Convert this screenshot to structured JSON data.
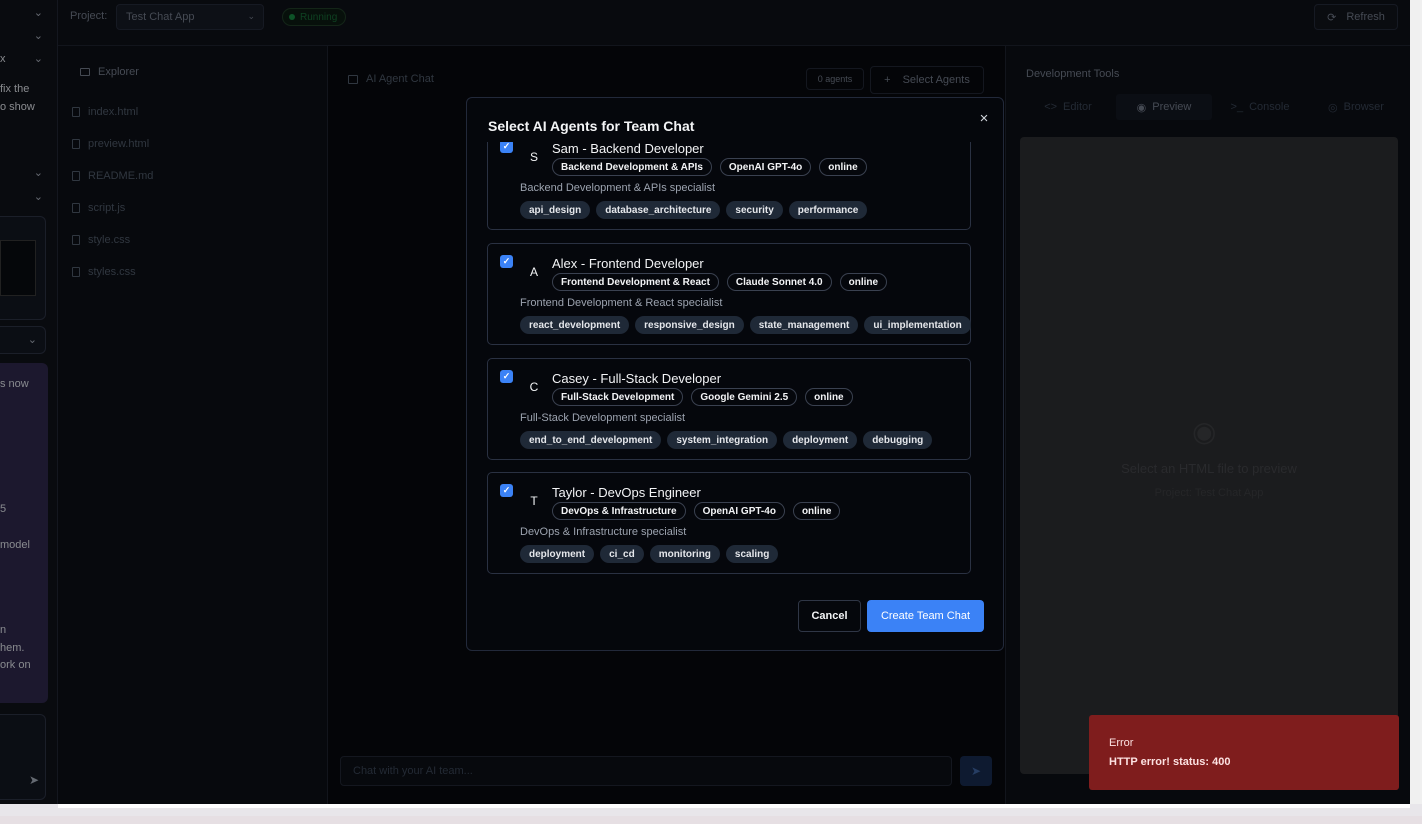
{
  "left_strip": {
    "texts": [
      "x",
      "fix the",
      "o show",
      "s now",
      "5",
      "model",
      "n",
      "hem.",
      "ork on"
    ]
  },
  "topbar": {
    "project_label": "Project:",
    "project_value": "Test Chat App",
    "status": "Running",
    "refresh_label": "Refresh"
  },
  "explorer": {
    "title": "Explorer",
    "files": [
      "index.html",
      "preview.html",
      "README.md",
      "script.js",
      "style.css",
      "styles.css"
    ]
  },
  "chat": {
    "title": "AI Agent Chat",
    "agents_count": "0 agents",
    "select_agents_label": "Select Agents",
    "input_placeholder": "Chat with your AI team..."
  },
  "devtools": {
    "title": "Development Tools",
    "tabs": [
      "Editor",
      "Preview",
      "Console",
      "Browser"
    ],
    "active_tab": "Preview",
    "preview_message": "Select an HTML file to preview",
    "preview_project": "Project: Test Chat App"
  },
  "modal": {
    "title": "Select AI Agents for Team Chat",
    "close": "×",
    "agents": [
      {
        "initial": "S",
        "name": "Sam - Backend Developer",
        "specialty": "Backend Development & APIs",
        "model": "OpenAI GPT-4o",
        "status": "online",
        "description": "Backend Development & APIs specialist",
        "skills": [
          "api_design",
          "database_architecture",
          "security",
          "performance"
        ],
        "checked": true
      },
      {
        "initial": "A",
        "name": "Alex - Frontend Developer",
        "specialty": "Frontend Development & React",
        "model": "Claude Sonnet 4.0",
        "status": "online",
        "description": "Frontend Development & React specialist",
        "skills": [
          "react_development",
          "responsive_design",
          "state_management",
          "ui_implementation"
        ],
        "checked": true
      },
      {
        "initial": "C",
        "name": "Casey - Full-Stack Developer",
        "specialty": "Full-Stack Development",
        "model": "Google Gemini 2.5",
        "status": "online",
        "description": "Full-Stack Development specialist",
        "skills": [
          "end_to_end_development",
          "system_integration",
          "deployment",
          "debugging"
        ],
        "checked": true
      },
      {
        "initial": "T",
        "name": "Taylor - DevOps Engineer",
        "specialty": "DevOps & Infrastructure",
        "model": "OpenAI GPT-4o",
        "status": "online",
        "description": "DevOps & Infrastructure specialist",
        "skills": [
          "deployment",
          "ci_cd",
          "monitoring",
          "scaling"
        ],
        "checked": true
      }
    ],
    "cancel_label": "Cancel",
    "create_label": "Create Team Chat"
  },
  "toast": {
    "title": "Error",
    "message": "HTTP error! status: 400"
  },
  "colors": {
    "accent": "#3b82f6",
    "error_bg": "#7f1d1d",
    "running": "#15803d"
  }
}
